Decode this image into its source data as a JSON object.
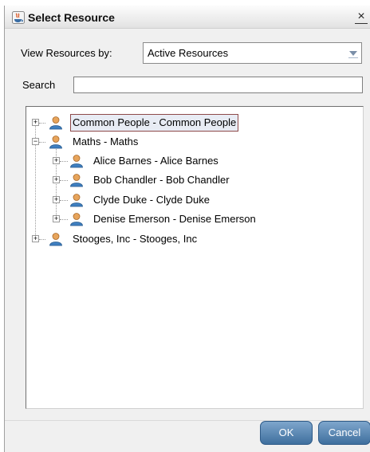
{
  "window": {
    "title": "Select Resource",
    "close_glyph": "×",
    "icon": "java-app-icon"
  },
  "view_by": {
    "label": "View Resources by:",
    "selected": "Active Resources"
  },
  "search": {
    "label": "Search",
    "value": "",
    "placeholder": ""
  },
  "tree": {
    "nodes": [
      {
        "label": "Common People - Common People",
        "level": 0,
        "expander": "+",
        "selected": true
      },
      {
        "label": "Maths - Maths",
        "level": 0,
        "expander": "−",
        "selected": false
      },
      {
        "label": "Alice Barnes - Alice Barnes",
        "level": 1,
        "expander": "+",
        "selected": false
      },
      {
        "label": "Bob Chandler - Bob Chandler",
        "level": 1,
        "expander": "+",
        "selected": false
      },
      {
        "label": "Clyde Duke - Clyde Duke",
        "level": 1,
        "expander": "+",
        "selected": false
      },
      {
        "label": "Denise Emerson - Denise Emerson",
        "level": 1,
        "expander": "+",
        "selected": false
      },
      {
        "label": "Stooges, Inc - Stooges, Inc",
        "level": 0,
        "expander": "+",
        "selected": false
      }
    ]
  },
  "buttons": {
    "ok": "OK",
    "cancel": "Cancel"
  },
  "colors": {
    "button_blue": "#4f7fae",
    "selection_border": "#8e4a4a"
  }
}
